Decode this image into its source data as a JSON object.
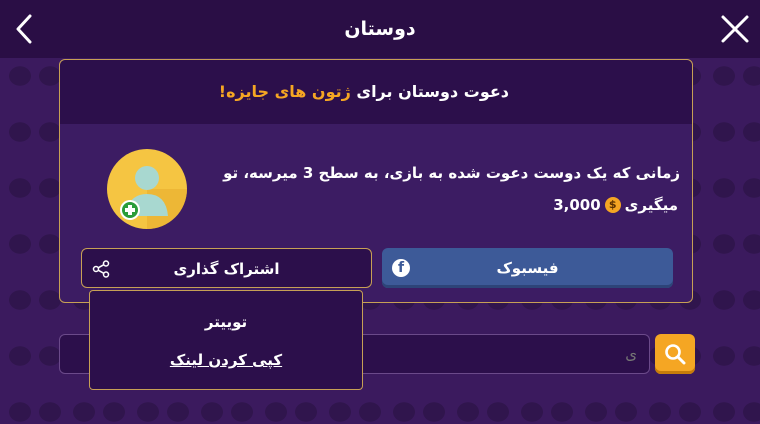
{
  "header": {
    "title": "دوستان",
    "back_icon": "chevron-left-icon",
    "close_icon": "close-icon"
  },
  "invite": {
    "title_prefix": "دعوت دوستان برای",
    "title_highlight": "ژتون های جایزه!",
    "description": "زمانی که یک دوست دعوت شده به بازی، به سطح 3 میرسه، تو",
    "reward_amount": "3,000",
    "reward_suffix": "میگیری",
    "coin_symbol": "$",
    "avatar_icon": "add-friend-avatar-icon"
  },
  "buttons": {
    "share_label": "اشتراک گذاری",
    "facebook_label": "فیسبوک"
  },
  "share_menu": {
    "twitter_label": "توییتر",
    "copy_link_label": "کپی کردن لینک"
  },
  "search": {
    "placeholder": "ی"
  },
  "colors": {
    "accent": "#f5a623",
    "facebook": "#3d5a98",
    "border_gold": "#c7a055",
    "background": "#3b1a5e"
  }
}
